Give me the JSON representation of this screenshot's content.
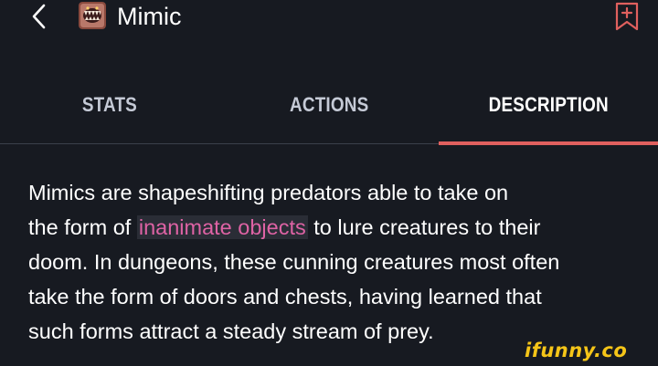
{
  "header": {
    "back_icon": "chevron-left-icon",
    "app_icon": "mimic-monster-icon",
    "title": "Mimic",
    "bookmark_icon": "bookmark-plus-icon"
  },
  "tabs": [
    {
      "label": "STATS",
      "active": false
    },
    {
      "label": "ACTIONS",
      "active": false
    },
    {
      "label": "DESCRIPTION",
      "active": true
    }
  ],
  "description": {
    "line1": "Mimics are shapeshifting predators able to take on",
    "line2_before": "the form of ",
    "line2_link": "inanimate objects",
    "line2_after": " to lure creatures to their",
    "line3": "doom. In dungeons, these cunning creatures most often",
    "line4": "take the form of doors and chests, having learned that",
    "line5": "such forms attract a steady stream of prey."
  },
  "watermark": "ifunny.co",
  "colors": {
    "background": "#171a21",
    "accent": "#e0605e",
    "link": "#df63a5",
    "watermark": "#f5c518"
  }
}
